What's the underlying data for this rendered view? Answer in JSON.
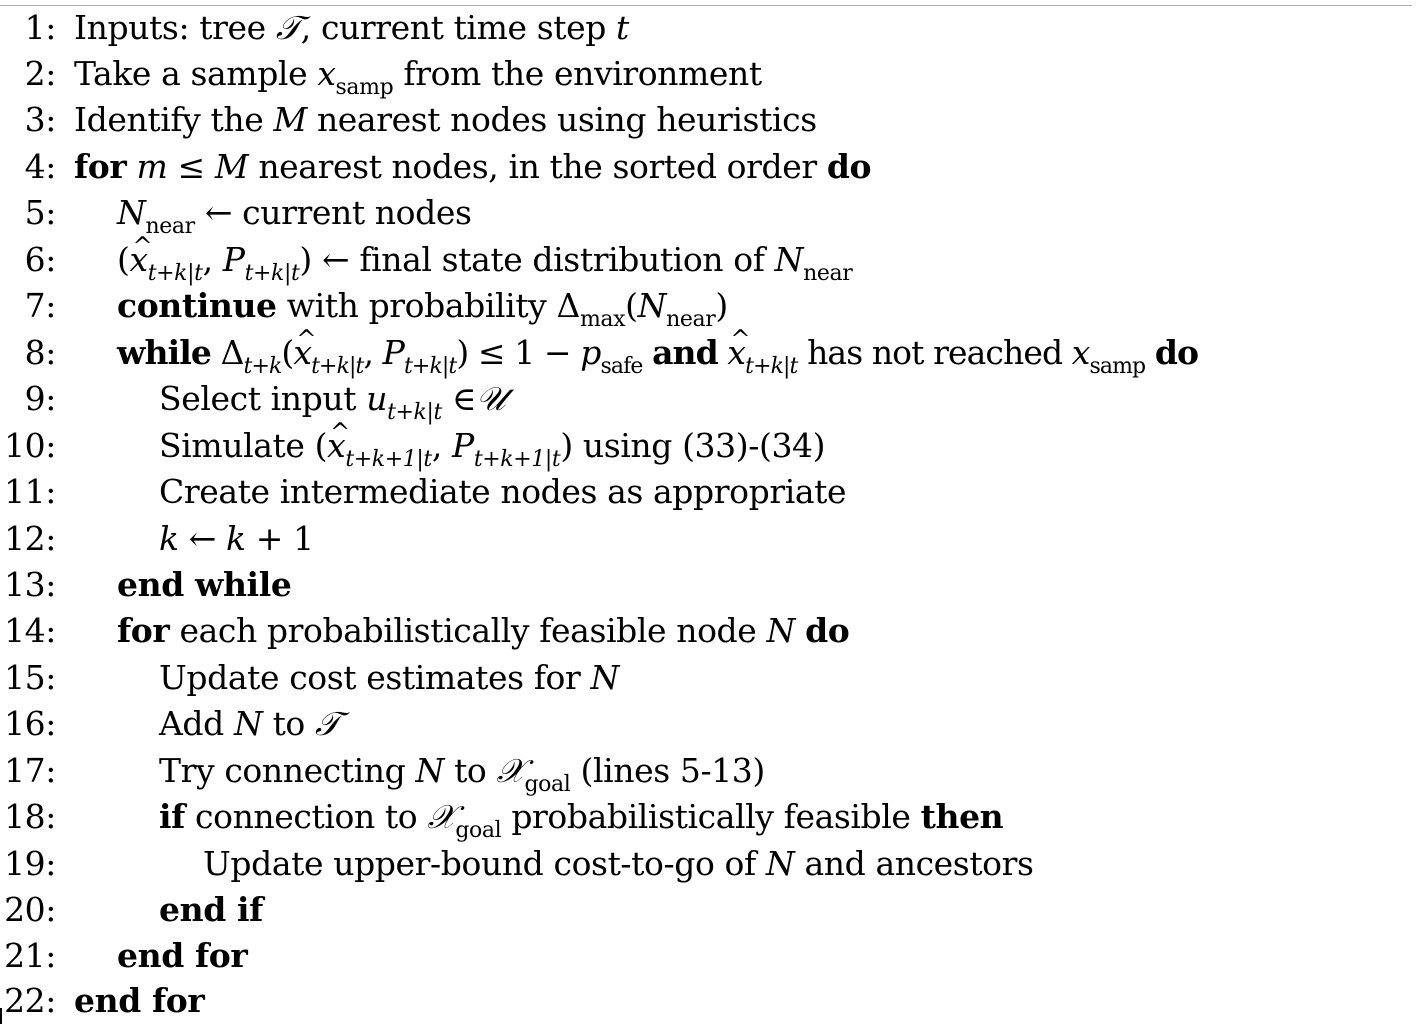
{
  "algorithm": {
    "line_numbers": [
      "1:",
      "2:",
      "3:",
      "4:",
      "5:",
      "6:",
      "7:",
      "8:",
      "9:",
      "10:",
      "11:",
      "12:",
      "13:",
      "14:",
      "15:",
      "16:",
      "17:",
      "18:",
      "19:",
      "20:",
      "21:",
      "22:"
    ],
    "l1": {
      "text": "Inputs: tree",
      "sym": "𝒯",
      "rest": ", current time step",
      "var": "t"
    },
    "l2": {
      "pre": "Take a sample",
      "var": "x",
      "sub": "samp",
      "post": "from the environment"
    },
    "l3": {
      "pre": "Identify the",
      "var": "M",
      "post": "nearest nodes using heuristics"
    },
    "l4": {
      "kw1": "for",
      "cond": "m ≤ M",
      "mid": "nearest nodes, in the sorted order",
      "kw2": "do"
    },
    "l5": {
      "var": "N",
      "sub": "near",
      "post": "← current nodes"
    },
    "l6": {
      "open": "(",
      "x": "x",
      "xsub": "t+k|t",
      "comma": ",",
      "p": "P",
      "psub": "t+k|t",
      "close": ")",
      "mid": "← final state distribution of",
      "n": "N",
      "nsub": "near"
    },
    "l7": {
      "kw": "continue",
      "mid": "with probability Δ",
      "sub": "max",
      "post1": "(",
      "n": "N",
      "nsub": "near",
      "post2": ")"
    },
    "l8": {
      "kw1": "while",
      "delta": "Δ",
      "dsub": "t+k",
      "open": "(",
      "x": "x",
      "xsub": "t+k|t",
      "comma": ",",
      "p": "P",
      "psub": "t+k|t",
      "close": ") ≤ 1 − ",
      "ps": "p",
      "pssub": "safe",
      "kw2": "and",
      "x2": "x",
      "x2sub": "t+k|t",
      "mid": "has not reached",
      "x3": "x",
      "x3sub": "samp",
      "kw3": "do"
    },
    "l9": {
      "pre": "Select input",
      "u": "u",
      "usub": "t+k|t",
      "post": "∈",
      "set": "𝒰"
    },
    "l10": {
      "pre": "Simulate (",
      "x": "x",
      "xsub": "t+k+1|t",
      "comma": ",",
      "p": "P",
      "psub": "t+k+1|t",
      "post": ") using (33)-(34)"
    },
    "l11": {
      "text": "Create intermediate nodes as appropriate"
    },
    "l12": {
      "a": "k",
      "arrow": " ← ",
      "b": "k",
      "post": " + 1"
    },
    "l13": {
      "kw": "end while"
    },
    "l14": {
      "kw1": "for",
      "mid": "each probabilistically feasible node",
      "var": "N",
      "kw2": "do"
    },
    "l15": {
      "pre": "Update cost estimates for",
      "var": "N"
    },
    "l16": {
      "pre": "Add",
      "var": "N",
      "mid": "to",
      "sym": "𝒯"
    },
    "l17": {
      "pre": "Try connecting",
      "var": "N",
      "mid": "to",
      "sym": "𝒳",
      "sub": "goal",
      "post": "(lines 5-13)"
    },
    "l18": {
      "kw1": "if",
      "mid": "connection to",
      "sym": "𝒳",
      "sub": "goal",
      "post": "probabilistically feasible",
      "kw2": "then"
    },
    "l19": {
      "pre": "Update upper-bound cost-to-go of",
      "var": "N",
      "post": "and ancestors"
    },
    "l20": {
      "kw": "end if"
    },
    "l21": {
      "kw": "end for"
    },
    "l22": {
      "kw": "end for"
    }
  }
}
